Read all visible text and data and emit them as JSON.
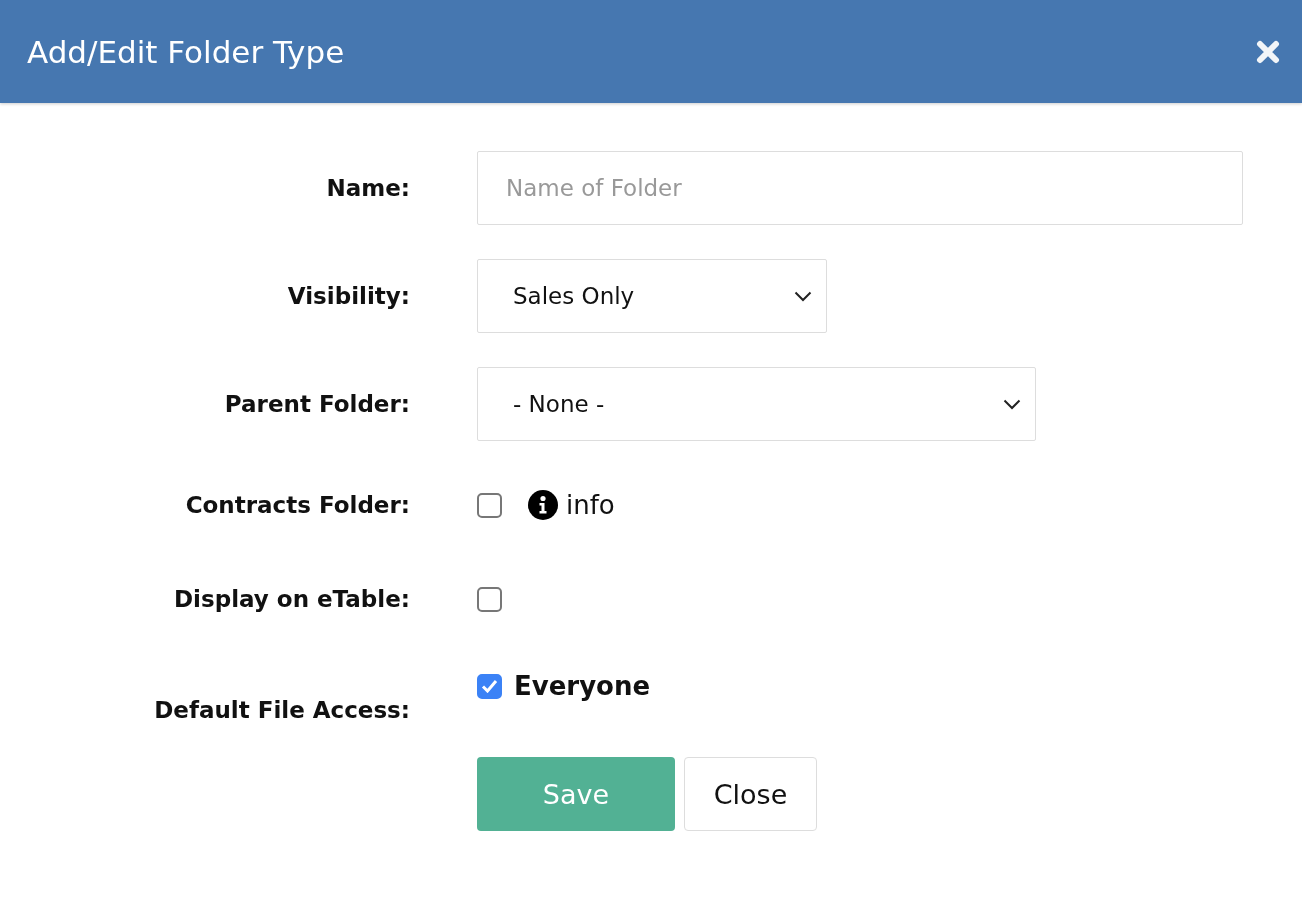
{
  "window": {
    "title": "Add/Edit Folder Type"
  },
  "fields": [
    {
      "kind": "text",
      "label": "Name:",
      "placeholder": "Name of Folder"
    },
    {
      "kind": "select",
      "label": "Visibility:",
      "value": "Sales Only"
    },
    {
      "kind": "select",
      "label": "Parent Folder:",
      "value": "- None -"
    },
    {
      "kind": "checkbox",
      "label": "Contracts Folder:",
      "checked": false,
      "info": "info"
    },
    {
      "kind": "checkbox",
      "label": "Display on eTable:",
      "checked": false
    },
    {
      "kind": "checkbox",
      "label": "Default File Access:",
      "checked": true,
      "option": "Everyone"
    }
  ],
  "buttons": [
    {
      "kind": "primary",
      "label": "Save"
    },
    {
      "kind": "secondary",
      "label": "Close"
    }
  ]
}
